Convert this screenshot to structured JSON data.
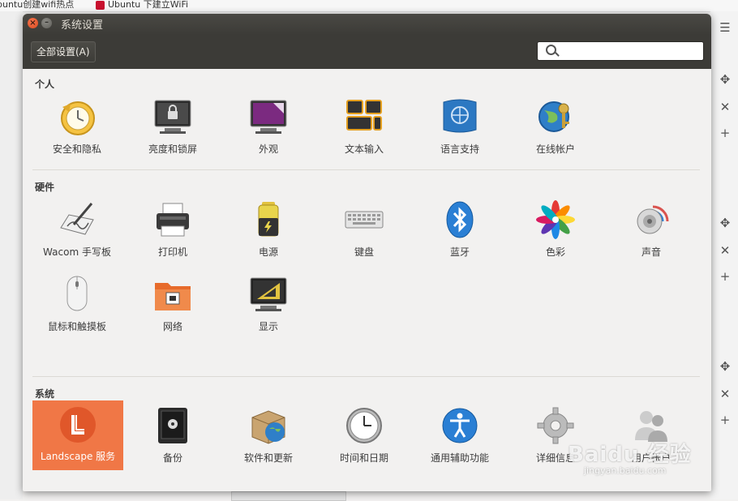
{
  "background": {
    "tabs": [
      {
        "label": "buntu创建wifi热点"
      },
      {
        "label": "Ubuntu 下建立WiFi"
      }
    ]
  },
  "window": {
    "title": "系统设置",
    "all_settings_label": "全部设置(A)",
    "search_placeholder": ""
  },
  "sections": [
    {
      "title": "个人",
      "items": [
        {
          "label": "安全和隐私",
          "icon": "security-privacy-icon"
        },
        {
          "label": "亮度和锁屏",
          "icon": "brightness-lock-icon"
        },
        {
          "label": "外观",
          "icon": "appearance-icon"
        },
        {
          "label": "文本输入",
          "icon": "text-entry-icon"
        },
        {
          "label": "语言支持",
          "icon": "language-support-icon"
        },
        {
          "label": "在线帐户",
          "icon": "online-accounts-icon"
        }
      ]
    },
    {
      "title": "硬件",
      "items": [
        {
          "label": "Wacom 手写板",
          "icon": "wacom-tablet-icon"
        },
        {
          "label": "打印机",
          "icon": "printer-icon"
        },
        {
          "label": "电源",
          "icon": "power-icon"
        },
        {
          "label": "键盘",
          "icon": "keyboard-icon"
        },
        {
          "label": "蓝牙",
          "icon": "bluetooth-icon"
        },
        {
          "label": "色彩",
          "icon": "color-icon"
        },
        {
          "label": "声音",
          "icon": "sound-icon"
        },
        {
          "label": "鼠标和触摸板",
          "icon": "mouse-touchpad-icon"
        },
        {
          "label": "网络",
          "icon": "network-icon"
        },
        {
          "label": "显示",
          "icon": "display-icon"
        }
      ]
    },
    {
      "title": "系统",
      "items": [
        {
          "label": "Landscape 服务",
          "icon": "landscape-icon",
          "selected": true
        },
        {
          "label": "备份",
          "icon": "backup-icon"
        },
        {
          "label": "软件和更新",
          "icon": "software-updates-icon"
        },
        {
          "label": "时间和日期",
          "icon": "time-date-icon"
        },
        {
          "label": "通用辅助功能",
          "icon": "universal-access-icon"
        },
        {
          "label": "详细信息",
          "icon": "details-icon"
        },
        {
          "label": "用户帐户",
          "icon": "user-accounts-icon"
        }
      ]
    }
  ],
  "watermark": {
    "text": "Baidu 经验",
    "url_text": "jingyan.baidu.com"
  },
  "colors": {
    "selected": "#f07746",
    "titlebar": "#3c3b37",
    "window_bg": "#f2f1f0"
  }
}
